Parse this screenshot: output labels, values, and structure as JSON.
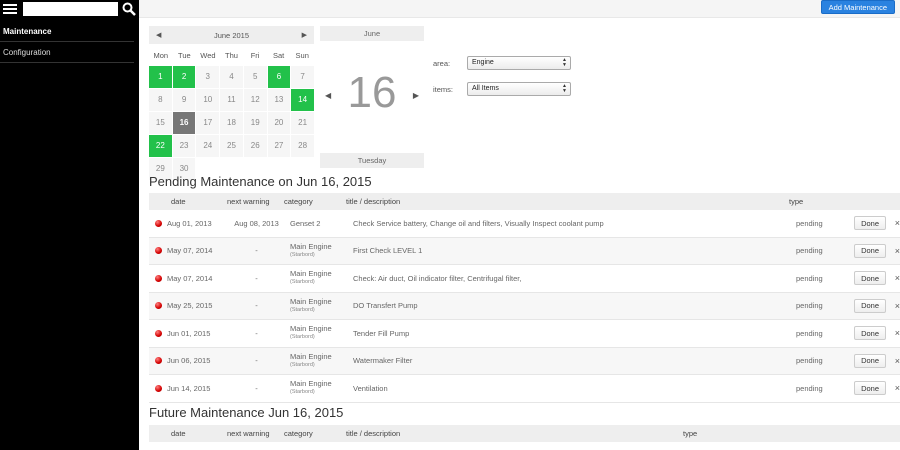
{
  "sidebar": {
    "search_placeholder": "",
    "items": [
      {
        "label": "Maintenance",
        "active": true
      },
      {
        "label": "Configuration",
        "active": false
      }
    ]
  },
  "toolbar": {
    "add_label": "Add Maintenance"
  },
  "calendar": {
    "title": "June 2015",
    "prev": "◀",
    "next": "▶",
    "weekdays": [
      "Mon",
      "Tue",
      "Wed",
      "Thu",
      "Fri",
      "Sat",
      "Sun"
    ],
    "weeks": [
      [
        {
          "d": "1",
          "s": "green"
        },
        {
          "d": "2",
          "s": "green"
        },
        {
          "d": "3",
          "s": ""
        },
        {
          "d": "4",
          "s": ""
        },
        {
          "d": "5",
          "s": ""
        },
        {
          "d": "6",
          "s": "green"
        },
        {
          "d": "7",
          "s": ""
        }
      ],
      [
        {
          "d": "8",
          "s": ""
        },
        {
          "d": "9",
          "s": ""
        },
        {
          "d": "10",
          "s": ""
        },
        {
          "d": "11",
          "s": ""
        },
        {
          "d": "12",
          "s": ""
        },
        {
          "d": "13",
          "s": ""
        },
        {
          "d": "14",
          "s": "green"
        }
      ],
      [
        {
          "d": "15",
          "s": ""
        },
        {
          "d": "16",
          "s": "today"
        },
        {
          "d": "17",
          "s": ""
        },
        {
          "d": "18",
          "s": ""
        },
        {
          "d": "19",
          "s": ""
        },
        {
          "d": "20",
          "s": ""
        },
        {
          "d": "21",
          "s": ""
        }
      ],
      [
        {
          "d": "22",
          "s": "green"
        },
        {
          "d": "23",
          "s": ""
        },
        {
          "d": "24",
          "s": ""
        },
        {
          "d": "25",
          "s": ""
        },
        {
          "d": "26",
          "s": ""
        },
        {
          "d": "27",
          "s": ""
        },
        {
          "d": "28",
          "s": ""
        }
      ],
      [
        {
          "d": "29",
          "s": ""
        },
        {
          "d": "30",
          "s": ""
        },
        {
          "d": "",
          "s": "empty"
        },
        {
          "d": "",
          "s": "empty"
        },
        {
          "d": "",
          "s": "empty"
        },
        {
          "d": "",
          "s": "empty"
        },
        {
          "d": "",
          "s": "empty"
        }
      ]
    ]
  },
  "day": {
    "month": "June",
    "number": "16",
    "weekday": "Tuesday",
    "prev": "◀",
    "next": "▶"
  },
  "filters": {
    "area_label": "area:",
    "area_value": "Engine",
    "items_label": "items:",
    "items_value": "All Items"
  },
  "pending": {
    "heading": "Pending Maintenance on Jun 16, 2015",
    "columns": {
      "date": "date",
      "next": "next warning",
      "category": "category",
      "title": "title / description",
      "type": "type"
    },
    "rows": [
      {
        "date": "Aug 01, 2013",
        "next": "Aug 08, 2013",
        "cat": "Genset 2",
        "sub": "",
        "title": "Check Service battery, Change oil and filters, Visually Inspect coolant pump",
        "type": "pending"
      },
      {
        "date": "May 07, 2014",
        "next": "-",
        "cat": "Main Engine",
        "sub": "(Starbord)",
        "title": "First Check LEVEL 1",
        "type": "pending"
      },
      {
        "date": "May 07, 2014",
        "next": "-",
        "cat": "Main Engine",
        "sub": "(Starbord)",
        "title": "Check: Air duct, Oil indicator filter, Centrifugal filter,",
        "type": "pending"
      },
      {
        "date": "May 25, 2015",
        "next": "-",
        "cat": "Main Engine",
        "sub": "(Starbord)",
        "title": "DO Transfert Pump",
        "type": "pending"
      },
      {
        "date": "Jun 01, 2015",
        "next": "-",
        "cat": "Main Engine",
        "sub": "(Starbord)",
        "title": "Tender Fill Pump",
        "type": "pending"
      },
      {
        "date": "Jun 06, 2015",
        "next": "-",
        "cat": "Main Engine",
        "sub": "(Starbord)",
        "title": "Watermaker Filter",
        "type": "pending"
      },
      {
        "date": "Jun 14, 2015",
        "next": "-",
        "cat": "Main Engine",
        "sub": "(Starbord)",
        "title": "Ventilation",
        "type": "pending"
      }
    ],
    "done_label": "Done",
    "remove_label": "×"
  },
  "future": {
    "heading": "Future Maintenance Jun 16, 2015",
    "columns": {
      "date": "date",
      "next": "next warning",
      "category": "category",
      "title": "title / description",
      "type": "type"
    }
  },
  "colors": {
    "accent": "#2a82e0",
    "green": "#22c14a",
    "today": "#777777",
    "status_red": "#d40000"
  }
}
